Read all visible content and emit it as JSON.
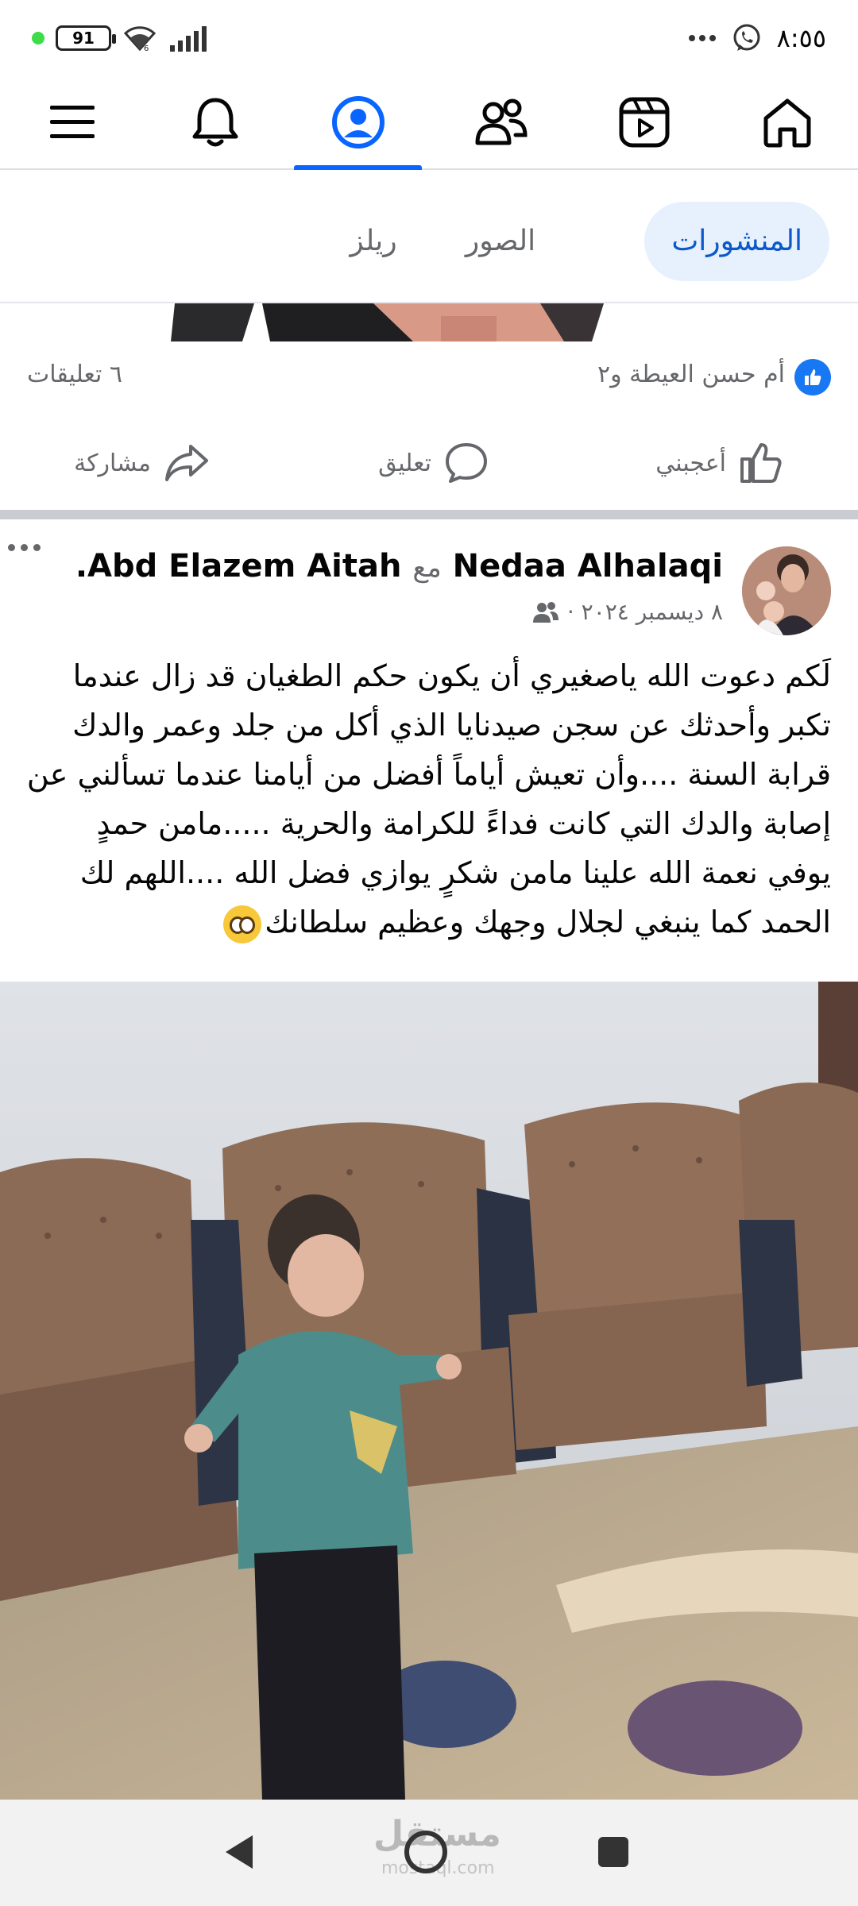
{
  "status_bar": {
    "battery": "91",
    "time": "٨:٥٥",
    "icons": [
      "notification-dot-icon",
      "battery-icon",
      "wifi-icon",
      "signal-icon",
      "more-icon",
      "whatsapp-icon"
    ]
  },
  "top_nav": {
    "items": [
      {
        "name": "home",
        "icon": "home-icon"
      },
      {
        "name": "reels",
        "icon": "video-icon"
      },
      {
        "name": "friends",
        "icon": "friends-icon"
      },
      {
        "name": "profile",
        "icon": "profile-icon",
        "active": true
      },
      {
        "name": "notifications",
        "icon": "bell-icon"
      },
      {
        "name": "menu",
        "icon": "menu-icon"
      }
    ],
    "accent": "#0866ff"
  },
  "tabs": {
    "posts": "المنشورات",
    "photos": "الصور",
    "reels": "ريلز"
  },
  "prev_post": {
    "reaction_names": "أم حسن العيطة و٢",
    "comment_count": "٦ تعليقات",
    "like_label": "أعجبني",
    "comment_label": "تعليق",
    "share_label": "مشاركة"
  },
  "post": {
    "author": "Nedaa Alhalaqi",
    "with_word": "مع",
    "tagged": "Abd Elazem Aitah",
    "date": "٨ ديسمبر ٢٠٢٤ ·",
    "lines": [
      "لَكم دعوت الله ياصغيري أن يكون حكم الطغيان قد زال عندما",
      "تكبر وأحدثك عن سجن صيدنايا الذي أكل من جلد وعمر والدك",
      "قرابة السنة ....وأن تعيش أياماً أفضل من أيامنا عندما تسألني عن",
      "إصابة والدك التي كانت فداءً للكرامة والحرية .....مامن حمدٍ",
      "يوفي نعمة الله علينا مامن شكرٍ يوازي  فضل الله ....اللهم لك",
      "الحمد كما ينبغي لجلال وجهك وعظيم سلطانك"
    ]
  },
  "watermark": {
    "text": "مستقل",
    "sub": "mostaql.com"
  }
}
